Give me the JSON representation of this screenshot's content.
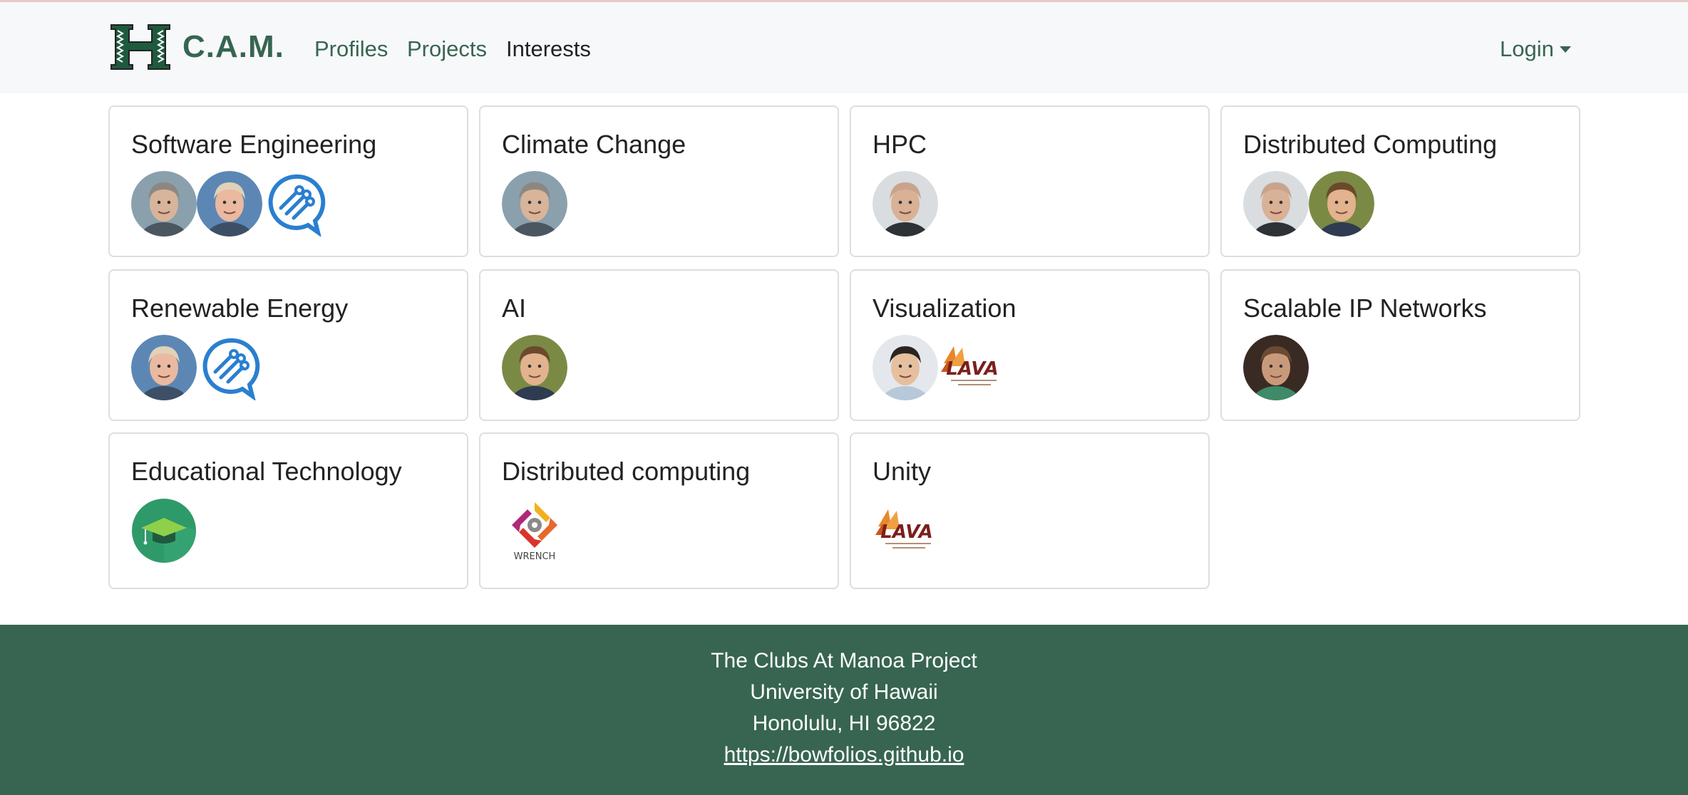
{
  "brand": {
    "name": "C.A.M.",
    "logo_icon": "uh-h-logo-icon",
    "color": "#376551"
  },
  "nav": {
    "items": [
      {
        "label": "Profiles",
        "active": false
      },
      {
        "label": "Projects",
        "active": false
      },
      {
        "label": "Interests",
        "active": true
      }
    ],
    "login_label": "Login"
  },
  "interests": [
    {
      "title": "Software Engineering",
      "members": [
        "avatar-man-gray-hair",
        "avatar-man-smiling-blond",
        "logo-chat-circuit-blue"
      ]
    },
    {
      "title": "Climate Change",
      "members": [
        "avatar-man-gray-hair"
      ]
    },
    {
      "title": "HPC",
      "members": [
        "avatar-man-bald-beard"
      ]
    },
    {
      "title": "Distributed Computing",
      "members": [
        "avatar-man-bald-beard",
        "avatar-man-sunglasses"
      ]
    },
    {
      "title": "Renewable Energy",
      "members": [
        "avatar-man-smiling-blond",
        "logo-chat-circuit-blue"
      ]
    },
    {
      "title": "AI",
      "members": [
        "avatar-man-sunglasses"
      ]
    },
    {
      "title": "Visualization",
      "members": [
        "avatar-man-asian-smiling",
        "logo-lava"
      ]
    },
    {
      "title": "Scalable IP Networks",
      "members": [
        "avatar-man-cowboy-hat"
      ]
    },
    {
      "title": "Educational Technology",
      "members": [
        "logo-graduation-cap-green"
      ]
    },
    {
      "title": "Distributed computing",
      "members": [
        "logo-wrench"
      ]
    },
    {
      "title": "Unity",
      "members": [
        "logo-lava"
      ]
    }
  ],
  "lava_text": "LAVA",
  "wrench_text": "WRENCH",
  "footer": {
    "line1": "The Clubs At Manoa Project",
    "line2": "University of Hawaii",
    "line3": "Honolulu, HI 96822",
    "link": "https://bowfolios.github.io",
    "background": "#376551"
  }
}
